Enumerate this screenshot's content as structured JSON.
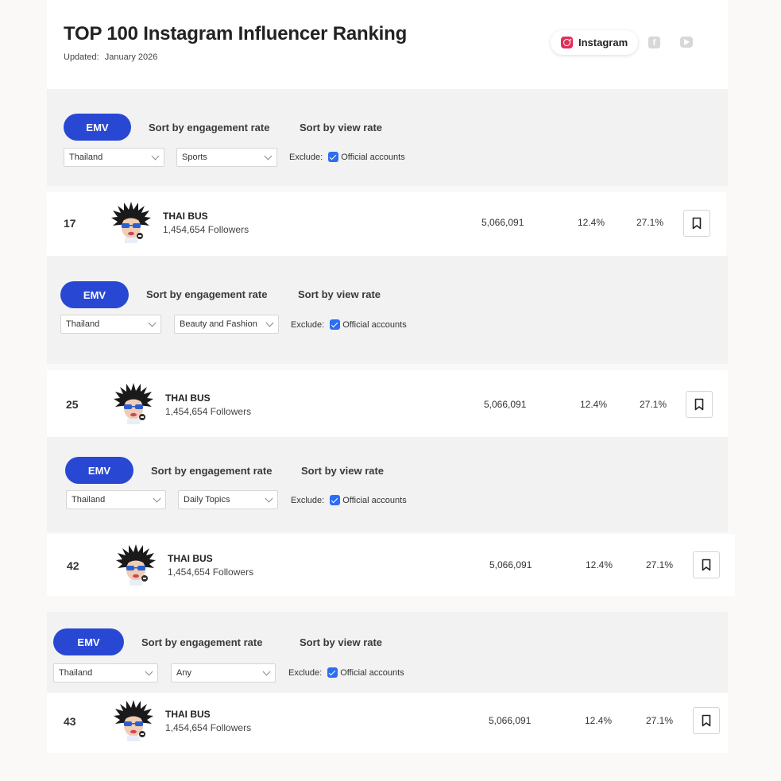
{
  "header": {
    "title": "TOP 100 Instagram Influencer Ranking",
    "updated_label": "Updated:",
    "updated_value": "January 2026",
    "platforms": [
      {
        "label": "Instagram",
        "icon": "instagram-icon",
        "active": true
      },
      {
        "label": "",
        "icon": "facebook-icon",
        "active": false
      },
      {
        "label": "",
        "icon": "youtube-icon",
        "active": false
      }
    ]
  },
  "filters": {
    "emv_label": "EMV",
    "sort_engagement_label": "Sort by engagement rate",
    "sort_view_label": "Sort by view rate",
    "exclude_label": "Exclude:",
    "official_accounts_label": "Official accounts"
  },
  "sections": [
    {
      "country": "Thailand",
      "category": "Sports",
      "row": {
        "rank": "17",
        "name": "THAI BUS",
        "followers": "1,454,654 Followers",
        "emv": "5,066,091",
        "engagement_rate": "12.4%",
        "view_rate": "27.1%"
      }
    },
    {
      "country": "Thailand",
      "category": "Beauty and Fashion",
      "row": {
        "rank": "25",
        "name": "THAI BUS",
        "followers": "1,454,654 Followers",
        "emv": "5,066,091",
        "engagement_rate": "12.4%",
        "view_rate": "27.1%"
      }
    },
    {
      "country": "Thailand",
      "category": "Daily Topics",
      "row": {
        "rank": "42",
        "name": "THAI BUS",
        "followers": "1,454,654 Followers",
        "emv": "5,066,091",
        "engagement_rate": "12.4%",
        "view_rate": "27.1%"
      }
    },
    {
      "country": "Thailand",
      "category": "Any",
      "row": {
        "rank": "43",
        "name": "THAI BUS",
        "followers": "1,454,654 Followers",
        "emv": "5,066,091",
        "engagement_rate": "12.4%",
        "view_rate": "27.1%"
      }
    }
  ],
  "colors": {
    "accent": "#2848d4",
    "checkbox": "#2f6df0",
    "instagram": "#e0305a",
    "panel_bg": "#f2f2f2"
  }
}
